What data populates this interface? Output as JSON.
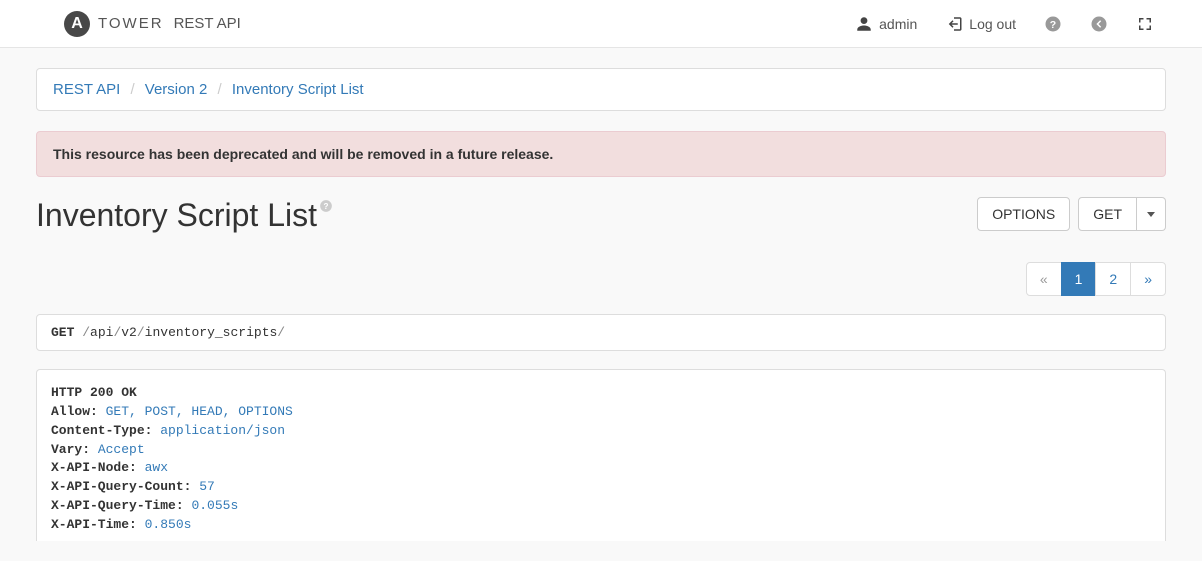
{
  "brand": {
    "badge": "A",
    "tower": "TOWER",
    "restapi": "REST API"
  },
  "topbar": {
    "user_label": "admin",
    "logout_label": "Log out"
  },
  "breadcrumb": {
    "items": [
      "REST API",
      "Version 2",
      "Inventory Script List"
    ]
  },
  "alert": {
    "text": "This resource has been deprecated and will be removed in a future release."
  },
  "page": {
    "title": "Inventory Script List"
  },
  "actions": {
    "options_label": "OPTIONS",
    "get_label": "GET"
  },
  "pagination": {
    "prev": "«",
    "next": "»",
    "pages": [
      "1",
      "2"
    ],
    "active": "1"
  },
  "request": {
    "method": "GET",
    "segments": [
      "api",
      "v2",
      "inventory_scripts"
    ]
  },
  "response": {
    "status": "HTTP 200 OK",
    "headers": [
      {
        "key": "Allow:",
        "value": "GET, POST, HEAD, OPTIONS"
      },
      {
        "key": "Content-Type:",
        "value": "application/json"
      },
      {
        "key": "Vary:",
        "value": "Accept"
      },
      {
        "key": "X-API-Node:",
        "value": "awx"
      },
      {
        "key": "X-API-Query-Count:",
        "value": "57"
      },
      {
        "key": "X-API-Query-Time:",
        "value": "0.055s"
      },
      {
        "key": "X-API-Time:",
        "value": "0.850s"
      }
    ]
  }
}
